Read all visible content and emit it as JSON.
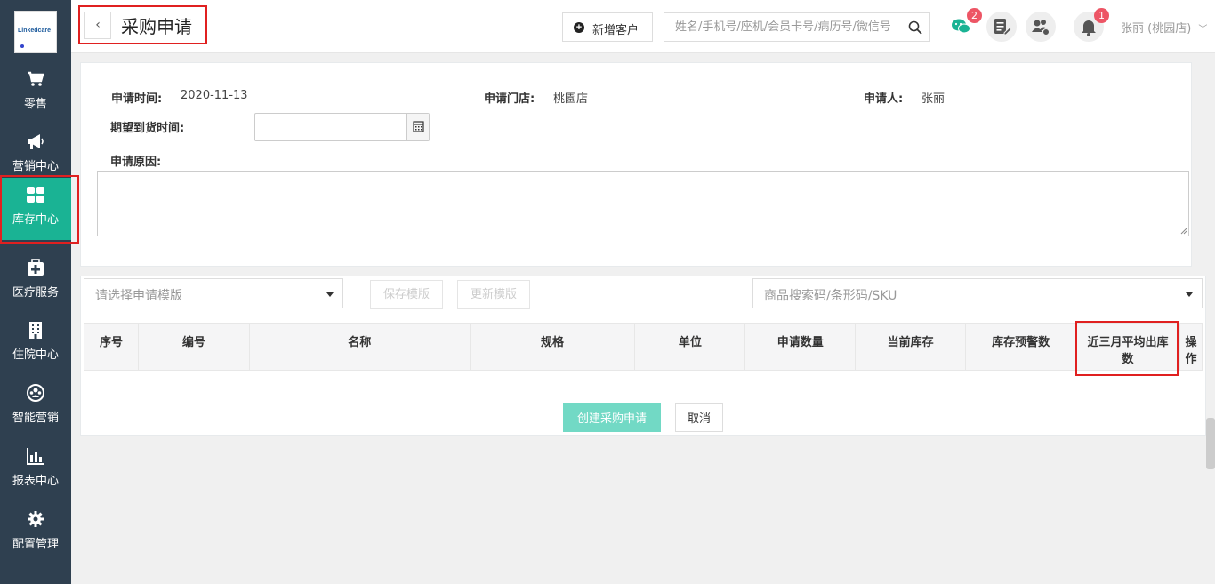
{
  "sidebar": {
    "logo_text": "Linkedcare",
    "items": [
      {
        "label": "零售",
        "icon": "cart-icon"
      },
      {
        "label": "营销中心",
        "icon": "megaphone-icon"
      },
      {
        "label": "库存中心",
        "icon": "grid-icon"
      },
      {
        "label": "医疗服务",
        "icon": "medical-kit-icon"
      },
      {
        "label": "住院中心",
        "icon": "building-icon"
      },
      {
        "label": "智能营销",
        "icon": "users-circle-icon"
      },
      {
        "label": "报表中心",
        "icon": "bar-chart-icon"
      },
      {
        "label": "配置管理",
        "icon": "gear-icon"
      }
    ],
    "active_index": 2,
    "active_color": "#1ab394",
    "bg_color": "#2f4050"
  },
  "header": {
    "back_label": "‹",
    "title": "采购申请",
    "add_customer_label": "新增客户",
    "search_placeholder": "姓名/手机号/座机/会员卡号/病历号/微信号",
    "wechat_badge": "2",
    "notify_badge": "1",
    "user_label": "张丽 (桃园店)"
  },
  "form": {
    "apply_time_label": "申请时间:",
    "apply_time_value": "2020-11-13",
    "store_label": "申请门店:",
    "store_value": "桃園店",
    "applicant_label": "申请人:",
    "applicant_value": "张丽",
    "expected_label": "期望到货时间:",
    "expected_value": "",
    "reason_label": "申请原因:",
    "reason_value": ""
  },
  "toolbar": {
    "template_placeholder": "请选择申请模版",
    "save_template_label": "保存模版",
    "update_template_label": "更新模版",
    "product_search_placeholder": "商品搜索码/条形码/SKU"
  },
  "table": {
    "headers": [
      "序号",
      "编号",
      "名称",
      "规格",
      "单位",
      "申请数量",
      "当前库存",
      "库存预警数",
      "近三月平均出库数",
      "操作"
    ]
  },
  "actions": {
    "create_label": "创建采购申请",
    "cancel_label": "取消"
  },
  "colors": {
    "highlight": "#e02020",
    "primary_light": "#72d9c5",
    "badge": "#ed5565"
  }
}
